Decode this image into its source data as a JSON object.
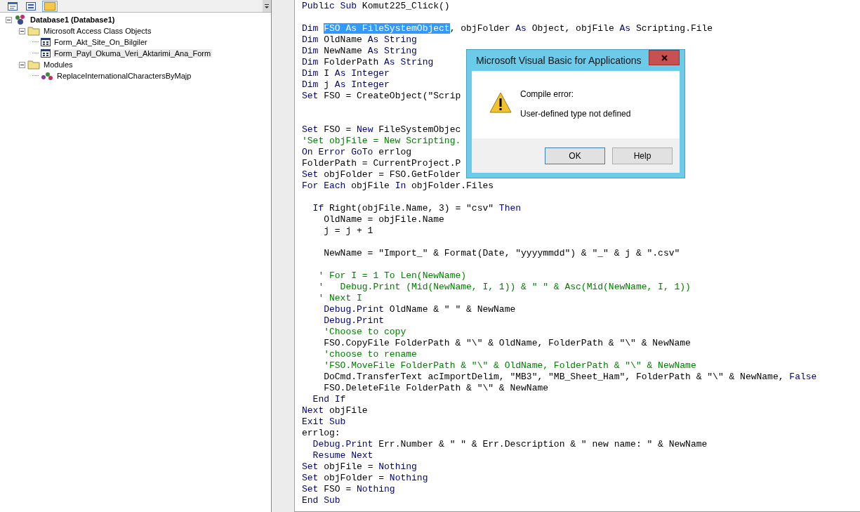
{
  "project_explorer": {
    "toolbar": [
      {
        "kind": "view-code",
        "selected": false
      },
      {
        "kind": "view-object",
        "selected": false
      },
      {
        "kind": "toggle-folders",
        "selected": true
      }
    ],
    "tree": [
      {
        "label": "Database1 (Database1)",
        "kind": "project",
        "expanded": true,
        "selected": false,
        "children": [
          {
            "label": "Microsoft Access Class Objects",
            "kind": "folder",
            "expanded": true,
            "selected": false,
            "children": [
              {
                "label": "Form_Akt_Site_On_Bilgiler",
                "kind": "form",
                "selected": false
              },
              {
                "label": "Form_Payl_Okuma_Veri_Aktarimi_Ana_Form",
                "kind": "form",
                "selected": true
              }
            ]
          },
          {
            "label": "Modules",
            "kind": "folder",
            "expanded": true,
            "selected": false,
            "children": [
              {
                "label": "ReplaceInternationalCharactersByMajp",
                "kind": "module",
                "selected": false
              }
            ]
          }
        ]
      }
    ]
  },
  "code": [
    {
      "kind": "code",
      "segments": [
        {
          "text": "Public Sub ",
          "kind": "keyword"
        },
        {
          "text": "Komut225_Click()",
          "kind": "plain"
        }
      ]
    },
    {
      "kind": "blank"
    },
    {
      "kind": "code",
      "segments": [
        {
          "text": "Dim ",
          "kind": "keyword"
        },
        {
          "text": "FSO As FileSystemObject",
          "kind": "selection"
        },
        {
          "text": ", objFolder ",
          "kind": "plain"
        },
        {
          "text": "As ",
          "kind": "keyword"
        },
        {
          "text": "Object, objFile ",
          "kind": "plain"
        },
        {
          "text": "As ",
          "kind": "keyword"
        },
        {
          "text": "Scripting.File",
          "kind": "plain"
        }
      ]
    },
    {
      "kind": "code",
      "segments": [
        {
          "text": "Dim ",
          "kind": "keyword"
        },
        {
          "text": "OldName ",
          "kind": "plain"
        },
        {
          "text": "As String",
          "kind": "keyword"
        }
      ]
    },
    {
      "kind": "code",
      "segments": [
        {
          "text": "Dim ",
          "kind": "keyword"
        },
        {
          "text": "NewName ",
          "kind": "plain"
        },
        {
          "text": "As String",
          "kind": "keyword"
        }
      ]
    },
    {
      "kind": "code",
      "segments": [
        {
          "text": "Dim ",
          "kind": "keyword"
        },
        {
          "text": "FolderPath ",
          "kind": "plain"
        },
        {
          "text": "As String",
          "kind": "keyword"
        }
      ]
    },
    {
      "kind": "code",
      "segments": [
        {
          "text": "Dim ",
          "kind": "keyword"
        },
        {
          "text": "I ",
          "kind": "plain"
        },
        {
          "text": "As Integer",
          "kind": "keyword"
        }
      ]
    },
    {
      "kind": "code",
      "segments": [
        {
          "text": "Dim ",
          "kind": "keyword"
        },
        {
          "text": "j ",
          "kind": "plain"
        },
        {
          "text": "As Integer",
          "kind": "keyword"
        }
      ]
    },
    {
      "kind": "code",
      "segments": [
        {
          "text": "Set ",
          "kind": "keyword"
        },
        {
          "text": "FSO = CreateObject(\"Scrip",
          "kind": "plain"
        }
      ]
    },
    {
      "kind": "blank"
    },
    {
      "kind": "blank"
    },
    {
      "kind": "code",
      "segments": [
        {
          "text": "Set ",
          "kind": "keyword"
        },
        {
          "text": "FSO = ",
          "kind": "plain"
        },
        {
          "text": "New ",
          "kind": "keyword"
        },
        {
          "text": "FileSystemObjec",
          "kind": "plain"
        }
      ]
    },
    {
      "kind": "code",
      "segments": [
        {
          "text": "'Set objFile = New Scripting.",
          "kind": "comment"
        }
      ]
    },
    {
      "kind": "code",
      "segments": [
        {
          "text": "On Error GoTo ",
          "kind": "keyword"
        },
        {
          "text": "errlog",
          "kind": "plain"
        }
      ]
    },
    {
      "kind": "code",
      "segments": [
        {
          "text": "FolderPath = CurrentProject.P",
          "kind": "plain"
        }
      ]
    },
    {
      "kind": "code",
      "segments": [
        {
          "text": "Set ",
          "kind": "keyword"
        },
        {
          "text": "objFolder = FSO.GetFolder",
          "kind": "plain"
        }
      ]
    },
    {
      "kind": "code",
      "segments": [
        {
          "text": "For Each ",
          "kind": "keyword"
        },
        {
          "text": "objFile ",
          "kind": "plain"
        },
        {
          "text": "In ",
          "kind": "keyword"
        },
        {
          "text": "objFolder.Files",
          "kind": "plain"
        }
      ]
    },
    {
      "kind": "blank"
    },
    {
      "kind": "code",
      "segments": [
        {
          "text": "  If ",
          "kind": "keyword"
        },
        {
          "text": "Right(objFile.Name, 3) = \"csv\" ",
          "kind": "plain"
        },
        {
          "text": "Then",
          "kind": "keyword"
        }
      ]
    },
    {
      "kind": "code",
      "segments": [
        {
          "text": "    OldName = objFile.Name",
          "kind": "plain"
        }
      ]
    },
    {
      "kind": "code",
      "segments": [
        {
          "text": "    j = j + 1",
          "kind": "plain"
        }
      ]
    },
    {
      "kind": "blank"
    },
    {
      "kind": "code",
      "segments": [
        {
          "text": "    NewName = \"Import_\" & Format(Date, \"yyyymmdd\") & \"_\" & j & \".csv\"",
          "kind": "plain"
        }
      ]
    },
    {
      "kind": "blank"
    },
    {
      "kind": "code",
      "segments": [
        {
          "text": "   ' For I = 1 To Len(NewName)",
          "kind": "comment"
        }
      ]
    },
    {
      "kind": "code",
      "segments": [
        {
          "text": "   '   Debug.Print (Mid(NewName, I, 1)) & \" \" & Asc(Mid(NewName, I, 1))",
          "kind": "comment"
        }
      ]
    },
    {
      "kind": "code",
      "segments": [
        {
          "text": "   ' Next I",
          "kind": "comment"
        }
      ]
    },
    {
      "kind": "code",
      "segments": [
        {
          "text": "    Debug.Print",
          "kind": "keyword"
        },
        {
          "text": " OldName & \" \" & NewName",
          "kind": "plain"
        }
      ]
    },
    {
      "kind": "code",
      "segments": [
        {
          "text": "    Debug.Print",
          "kind": "keyword"
        }
      ]
    },
    {
      "kind": "code",
      "segments": [
        {
          "text": "    'Choose to copy",
          "kind": "comment"
        }
      ]
    },
    {
      "kind": "code",
      "segments": [
        {
          "text": "    FSO.CopyFile FolderPath & \"\\\" & OldName, FolderPath & \"\\\" & NewName",
          "kind": "plain"
        }
      ]
    },
    {
      "kind": "code",
      "segments": [
        {
          "text": "    'choose to rename",
          "kind": "comment"
        }
      ]
    },
    {
      "kind": "code",
      "segments": [
        {
          "text": "    'FSO.MoveFile FolderPath & \"\\\" & OldName, FolderPath & \"\\\" & NewName",
          "kind": "comment"
        }
      ]
    },
    {
      "kind": "code",
      "segments": [
        {
          "text": "    DoCmd.TransferText acImportDelim, \"MB3\", \"MB_Sheet_Ham\", FolderPath & \"\\\" & NewName, ",
          "kind": "plain"
        },
        {
          "text": "False",
          "kind": "keyword"
        }
      ]
    },
    {
      "kind": "code",
      "segments": [
        {
          "text": "    FSO.DeleteFile FolderPath & \"\\\" & NewName",
          "kind": "plain"
        }
      ]
    },
    {
      "kind": "code",
      "segments": [
        {
          "text": "  End If",
          "kind": "keyword"
        }
      ]
    },
    {
      "kind": "code",
      "segments": [
        {
          "text": "Next ",
          "kind": "keyword"
        },
        {
          "text": "objFile",
          "kind": "plain"
        }
      ]
    },
    {
      "kind": "code",
      "segments": [
        {
          "text": "Exit Sub",
          "kind": "keyword"
        }
      ]
    },
    {
      "kind": "code",
      "segments": [
        {
          "text": "errlog:",
          "kind": "plain"
        }
      ]
    },
    {
      "kind": "code",
      "segments": [
        {
          "text": "  Debug.Print",
          "kind": "keyword"
        },
        {
          "text": " Err.Number & \" \" & Err.Description & \" new name: \" & NewName",
          "kind": "plain"
        }
      ]
    },
    {
      "kind": "code",
      "segments": [
        {
          "text": "  Resume Next",
          "kind": "keyword"
        }
      ]
    },
    {
      "kind": "code",
      "segments": [
        {
          "text": "Set ",
          "kind": "keyword"
        },
        {
          "text": "objFile = ",
          "kind": "plain"
        },
        {
          "text": "Nothing",
          "kind": "keyword"
        }
      ]
    },
    {
      "kind": "code",
      "segments": [
        {
          "text": "Set ",
          "kind": "keyword"
        },
        {
          "text": "objFolder = ",
          "kind": "plain"
        },
        {
          "text": "Nothing",
          "kind": "keyword"
        }
      ]
    },
    {
      "kind": "code",
      "segments": [
        {
          "text": "Set ",
          "kind": "keyword"
        },
        {
          "text": "FSO = ",
          "kind": "plain"
        },
        {
          "text": "Nothing",
          "kind": "keyword"
        }
      ]
    },
    {
      "kind": "code",
      "segments": [
        {
          "text": "End Sub",
          "kind": "keyword"
        }
      ]
    }
  ],
  "dialog": {
    "title": "Microsoft Visual Basic for Applications",
    "heading": "Compile error:",
    "message": "User-defined type not defined",
    "buttons": [
      "OK",
      "Help"
    ]
  }
}
